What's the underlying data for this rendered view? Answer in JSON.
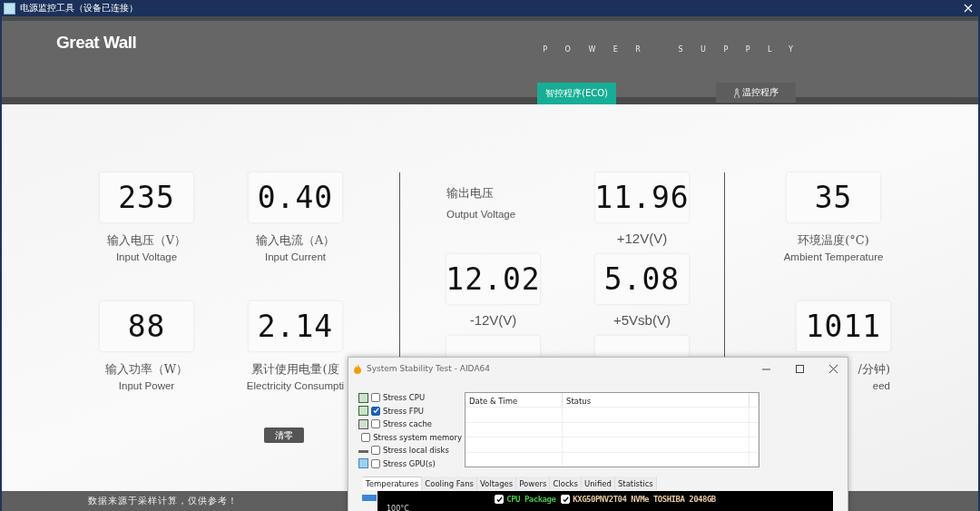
{
  "window": {
    "title": "电源监控工具（设备已连接）"
  },
  "header": {
    "brand": "Great Wall",
    "tagline": "POWER SUPPLY"
  },
  "tabs": [
    {
      "label": "智控程序(ECO)",
      "selected": true
    },
    {
      "label": "温控程序",
      "selected": false
    }
  ],
  "input_meters": [
    {
      "reading": "235",
      "label_cn": "输入电压（V）",
      "label_en": "Input Voltage"
    },
    {
      "reading": "0.40",
      "label_cn": "输入电流（A）",
      "label_en": "Input Current"
    },
    {
      "reading": "88",
      "label_cn": "输入功率（W）",
      "label_en": "Input Power"
    },
    {
      "reading": "2.14",
      "label_cn": "累计使用电量(度",
      "label_en": "Electricity Consumpti"
    }
  ],
  "clear_button": "清零",
  "output": {
    "title_cn": "输出电压",
    "title_en": "Output Voltage",
    "meters": [
      {
        "reading": "11.96",
        "label": "+12V(V)"
      },
      {
        "reading": "12.02",
        "label": "-12V(V)"
      },
      {
        "reading": "5.08",
        "label": "+5Vsb(V)"
      }
    ]
  },
  "ambient_meters": [
    {
      "reading": "35",
      "label_cn": "环境温度(°C)",
      "label_en": "Ambient Temperature"
    },
    {
      "reading": "1011",
      "label_cn": "/分钟)",
      "label_en": "eed"
    }
  ],
  "footer_note": "数据来源于采样计算，仅供参考！",
  "aida": {
    "title": "System Stability Test - AIDA64",
    "checks": [
      {
        "label": "Stress CPU",
        "checked": false
      },
      {
        "label": "Stress FPU",
        "checked": true
      },
      {
        "label": "Stress cache",
        "checked": false
      },
      {
        "label": "Stress system memory",
        "checked": false
      },
      {
        "label": "Stress local disks",
        "checked": false
      },
      {
        "label": "Stress GPU(s)",
        "checked": false
      }
    ],
    "columns": [
      "Date & Time",
      "Status"
    ],
    "tabs": [
      {
        "label": "Temperatures",
        "selected": true
      },
      {
        "label": "Cooling Fans",
        "selected": false
      },
      {
        "label": "Voltages",
        "selected": false
      },
      {
        "label": "Powers",
        "selected": false
      },
      {
        "label": "Clocks",
        "selected": false
      },
      {
        "label": "Unified",
        "selected": false
      },
      {
        "label": "Statistics",
        "selected": false
      }
    ],
    "legend": [
      {
        "label": "CPU Package",
        "checked": true,
        "color": "#4cc14c"
      },
      {
        "label": "KXG50PNV2T04 NVMe TOSHIBA 2048GB",
        "checked": true,
        "color": "#e6c9a0"
      }
    ],
    "axis_label": "100°C"
  }
}
